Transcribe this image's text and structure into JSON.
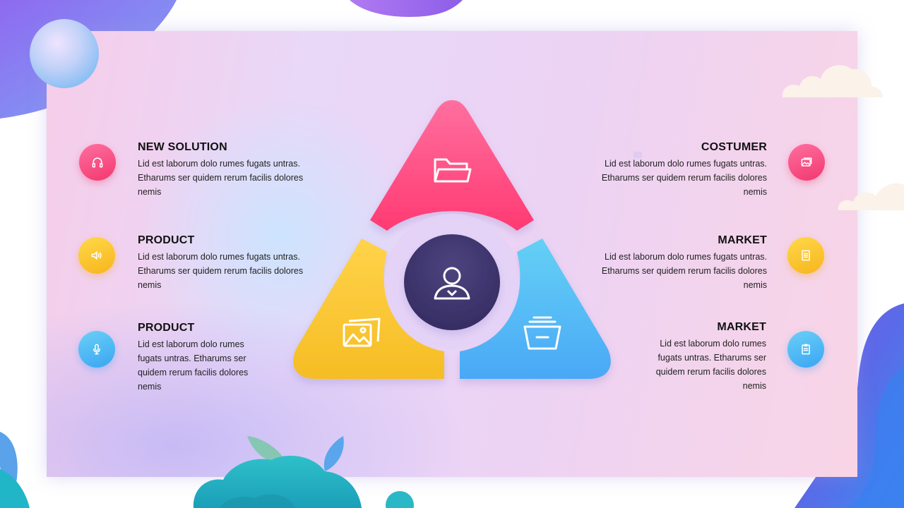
{
  "left_items": [
    {
      "title": "NEW SOLUTION",
      "line1": "Lid est laborum dolo rumes fugats untras.",
      "line2": "Etharums ser quidem rerum facilis dolores",
      "line3": "nemis",
      "icon": "headphones-icon",
      "color": "#f2386f"
    },
    {
      "title": "PRODUCT",
      "line1": "Lid est laborum dolo rumes fugats untras.",
      "line2": "Etharums ser quidem rerum facilis dolores",
      "line3": "nemis",
      "icon": "speaker-icon",
      "color": "#f7b51d"
    },
    {
      "title": "PRODUCT",
      "line1": "Lid est laborum dolo rumes",
      "line2": "fugats untras. Etharums ser",
      "line3": "quidem rerum facilis dolores",
      "line4": "nemis",
      "icon": "microphone-icon",
      "color": "#3aa5f2"
    }
  ],
  "right_items": [
    {
      "title": "COSTUMER",
      "line1": "Lid est laborum dolo rumes fugats untras.",
      "line2": "Etharums ser quidem rerum facilis dolores",
      "line3": "nemis",
      "icon": "picture-icon",
      "color": "#f2386f"
    },
    {
      "title": "MARKET",
      "line1": "Lid est laborum dolo rumes fugats untras.",
      "line2": "Etharums ser quidem rerum facilis dolores",
      "line3": "nemis",
      "icon": "document-icon",
      "color": "#f7b51d"
    },
    {
      "title": "MARKET",
      "line1": "Lid est laborum dolo rumes",
      "line2": "fugats untras. Etharums ser",
      "line3": "quidem rerum facilis dolores",
      "line4": "nemis",
      "icon": "clipboard-icon",
      "color": "#3aa5f2"
    }
  ],
  "diagram": {
    "top_segment_icon": "folder-icon",
    "left_segment_icon": "images-icon",
    "right_segment_icon": "archive-box-icon",
    "center_icon": "user-icon",
    "colors": {
      "pink": "#ff4f84",
      "yellow": "#f9c22b",
      "blue": "#4fb6f7",
      "center": "#3f3670"
    }
  }
}
